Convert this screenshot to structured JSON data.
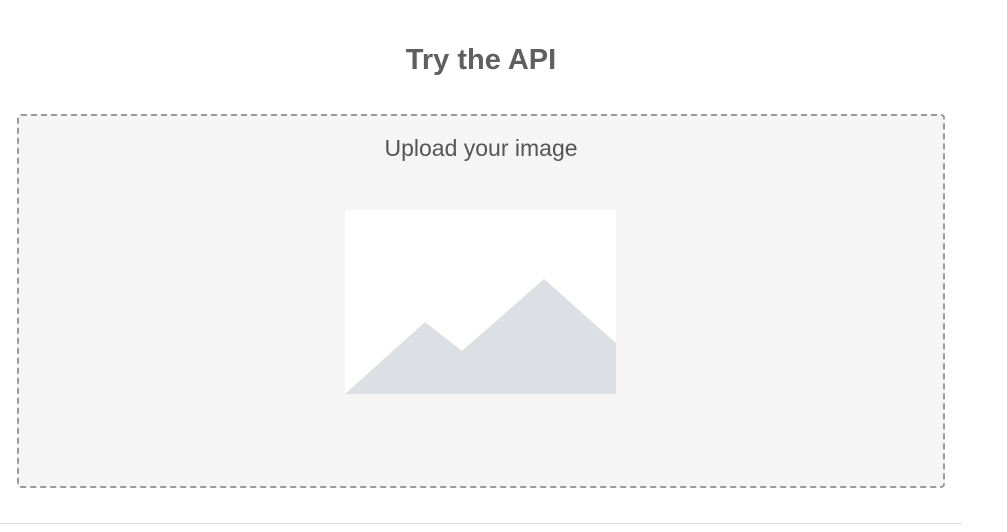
{
  "section": {
    "title": "Try the API"
  },
  "upload": {
    "label": "Upload your image",
    "placeholder_icon": "image-placeholder-icon"
  },
  "colors": {
    "title_text": "#5f5f5f",
    "dropzone_bg": "#f5f5f5",
    "dropzone_border": "#9a9a9a",
    "placeholder_bg": "#ffffff",
    "placeholder_mountains": "#dcdfe3"
  }
}
